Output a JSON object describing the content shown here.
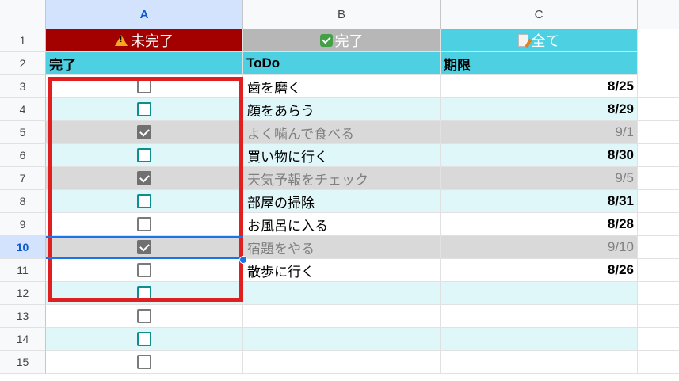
{
  "columns": [
    "A",
    "B",
    "C"
  ],
  "row_numbers": [
    "1",
    "2",
    "3",
    "4",
    "5",
    "6",
    "7",
    "8",
    "9",
    "10",
    "11",
    "12",
    "13",
    "14",
    "15"
  ],
  "filter_buttons": {
    "incomplete": {
      "label": "未完了",
      "color": "#a30000",
      "icon": "warning-icon"
    },
    "complete": {
      "label": "完了",
      "color": "#b7b7b7",
      "icon": "check-icon"
    },
    "all": {
      "label": "全て",
      "color": "#4dd0e1",
      "icon": "memo-icon"
    }
  },
  "headers": {
    "done": "完了",
    "todo": "ToDo",
    "deadline": "期限"
  },
  "tasks": [
    {
      "done": false,
      "todo": "歯を磨く",
      "deadline": "8/25"
    },
    {
      "done": false,
      "todo": "顔をあらう",
      "deadline": "8/29"
    },
    {
      "done": true,
      "todo": "よく噛んで食べる",
      "deadline": "9/1"
    },
    {
      "done": false,
      "todo": "買い物に行く",
      "deadline": "8/30"
    },
    {
      "done": true,
      "todo": "天気予報をチェック",
      "deadline": "9/5"
    },
    {
      "done": false,
      "todo": "部屋の掃除",
      "deadline": "8/31"
    },
    {
      "done": false,
      "todo": "お風呂に入る",
      "deadline": "8/28"
    },
    {
      "done": true,
      "todo": "宿題をやる",
      "deadline": "9/10"
    },
    {
      "done": false,
      "todo": "散歩に行く",
      "deadline": "8/26"
    },
    {
      "done": false,
      "todo": "",
      "deadline": ""
    },
    {
      "done": false,
      "todo": "",
      "deadline": ""
    },
    {
      "done": false,
      "todo": "",
      "deadline": ""
    },
    {
      "done": false,
      "todo": "",
      "deadline": ""
    }
  ],
  "selected": {
    "column": "A",
    "row": "10"
  }
}
